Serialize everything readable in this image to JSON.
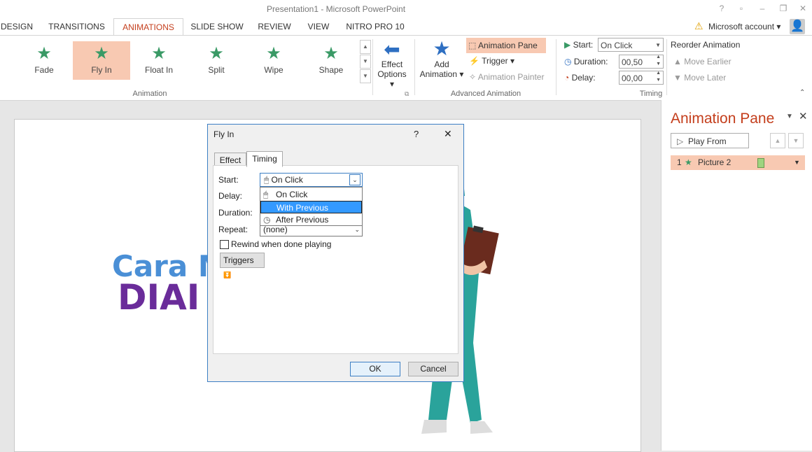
{
  "window": {
    "title": "Presentation1 - Microsoft PowerPoint",
    "help": "?",
    "account": "Microsoft account"
  },
  "tabs": [
    "DESIGN",
    "TRANSITIONS",
    "ANIMATIONS",
    "SLIDE SHOW",
    "REVIEW",
    "VIEW",
    "NITRO PRO 10"
  ],
  "ribbon": {
    "animation_gallery": [
      "Fade",
      "Fly In",
      "Float In",
      "Split",
      "Wipe",
      "Shape"
    ],
    "effect_options": {
      "line1": "Effect",
      "line2": "Options"
    },
    "group_animation": "Animation",
    "add_animation": {
      "line1": "Add",
      "line2": "Animation"
    },
    "animation_pane_btn": "Animation Pane",
    "trigger_btn": "Trigger",
    "animation_painter_btn": "Animation Painter",
    "group_advanced": "Advanced Animation",
    "start_label": "Start:",
    "start_value": "On Click",
    "duration_label": "Duration:",
    "duration_value": "00,50",
    "delay_label": "Delay:",
    "delay_value": "00,00",
    "group_timing": "Timing",
    "reorder_title": "Reorder Animation",
    "move_earlier": "Move Earlier",
    "move_later": "Move Later"
  },
  "slide": {
    "line1": "Cara M",
    "line2": "DIAI"
  },
  "pane": {
    "title": "Animation Pane",
    "play_from": "Play From",
    "item_number": "1",
    "item_name": "Picture 2"
  },
  "dialog": {
    "title": "Fly In",
    "help": "?",
    "tab_effect": "Effect",
    "tab_timing": "Timing",
    "start_label": "Start:",
    "start_value": "On Click",
    "delay_label": "Delay:",
    "duration_label": "Duration:",
    "repeat_label": "Repeat:",
    "repeat_value": "(none)",
    "dropdown_options": [
      "On Click",
      "With Previous",
      "After Previous"
    ],
    "rewind_label": "Rewind when done playing",
    "triggers_label": "Triggers",
    "ok": "OK",
    "cancel": "Cancel"
  },
  "colors": {
    "accent": "#c43e1c",
    "selection": "#f8c9b2",
    "highlight": "#3399ff",
    "star": "#3a9a66"
  }
}
